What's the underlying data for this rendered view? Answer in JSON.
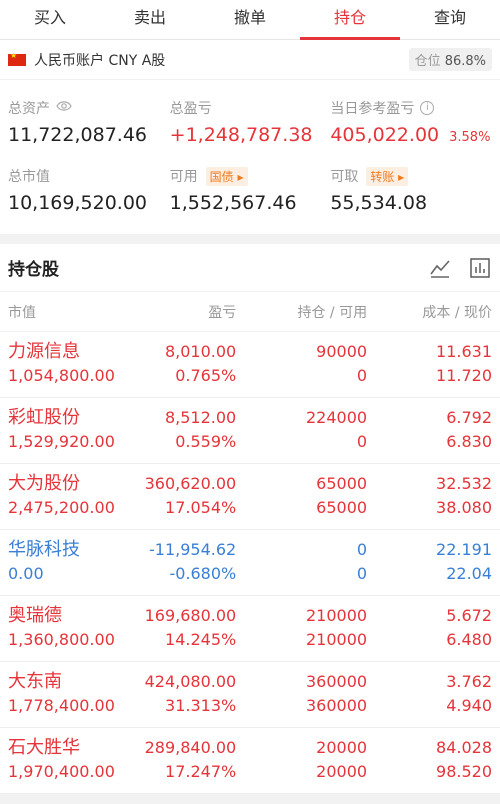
{
  "tabs": [
    "买入",
    "卖出",
    "撤单",
    "持仓",
    "查询"
  ],
  "account": {
    "name": "人民币账户 CNY A股",
    "position_label": "仓位",
    "position_value": "86.8%"
  },
  "summary": {
    "total_assets_label": "总资产",
    "total_assets": "11,722,087.46",
    "total_pnl_label": "总盈亏",
    "total_pnl": "+1,248,787.38",
    "today_pnl_label": "当日参考盈亏",
    "today_pnl": "405,022.00",
    "today_pnl_pct": "3.58%",
    "market_value_label": "总市值",
    "market_value": "10,169,520.00",
    "available_label": "可用",
    "available_tag": "国债",
    "available": "1,552,567.46",
    "withdrawable_label": "可取",
    "withdrawable_tag": "转账",
    "withdrawable": "55,534.08"
  },
  "holdings": {
    "title": "持仓股",
    "columns": [
      "市值",
      "盈亏",
      "持仓 / 可用",
      "成本 / 现价"
    ],
    "rows": [
      {
        "name": "力源信息",
        "market_value": "1,054,800.00",
        "pnl": "8,010.00",
        "pnl_pct": "0.765%",
        "position": "90000",
        "available": "0",
        "cost": "11.631",
        "price": "11.720",
        "color": "red"
      },
      {
        "name": "彩虹股份",
        "market_value": "1,529,920.00",
        "pnl": "8,512.00",
        "pnl_pct": "0.559%",
        "position": "224000",
        "available": "0",
        "cost": "6.792",
        "price": "6.830",
        "color": "red"
      },
      {
        "name": "大为股份",
        "market_value": "2,475,200.00",
        "pnl": "360,620.00",
        "pnl_pct": "17.054%",
        "position": "65000",
        "available": "65000",
        "cost": "32.532",
        "price": "38.080",
        "color": "red"
      },
      {
        "name": "华脉科技",
        "market_value": "0.00",
        "pnl": "-11,954.62",
        "pnl_pct": "-0.680%",
        "position": "0",
        "available": "0",
        "cost": "22.191",
        "price": "22.04",
        "color": "blue"
      },
      {
        "name": "奥瑞德",
        "market_value": "1,360,800.00",
        "pnl": "169,680.00",
        "pnl_pct": "14.245%",
        "position": "210000",
        "available": "210000",
        "cost": "5.672",
        "price": "6.480",
        "color": "red"
      },
      {
        "name": "大东南",
        "market_value": "1,778,400.00",
        "pnl": "424,080.00",
        "pnl_pct": "31.313%",
        "position": "360000",
        "available": "360000",
        "cost": "3.762",
        "price": "4.940",
        "color": "red"
      },
      {
        "name": "石大胜华",
        "market_value": "1,970,400.00",
        "pnl": "289,840.00",
        "pnl_pct": "17.247%",
        "position": "20000",
        "available": "20000",
        "cost": "84.028",
        "price": "98.520",
        "color": "red"
      }
    ]
  }
}
